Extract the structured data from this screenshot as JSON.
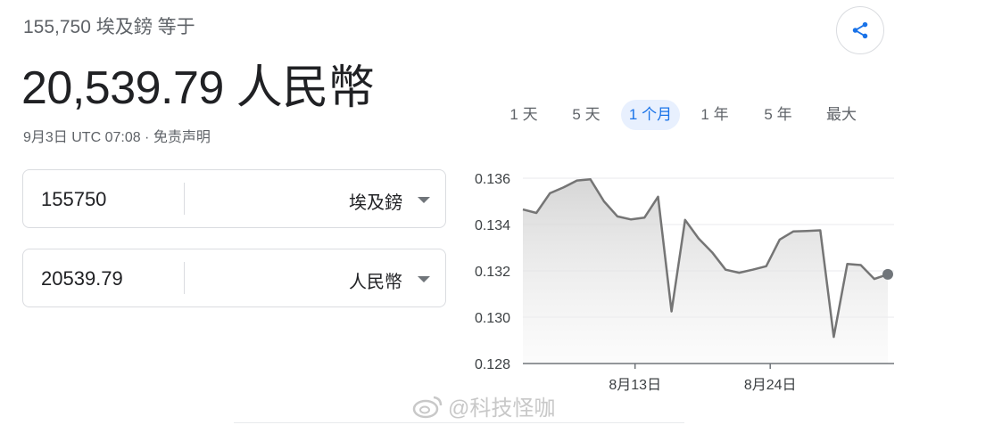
{
  "header": {
    "subtitle": "155,750 埃及鎊 等于",
    "result": "20,539.79 人民幣",
    "meta": "9月3日 UTC 07:08 · 免责声明"
  },
  "converter": {
    "from": {
      "value": "155750",
      "currency": "埃及鎊"
    },
    "to": {
      "value": "20539.79",
      "currency": "人民幣"
    }
  },
  "tabs": [
    {
      "label": "1 天",
      "active": false
    },
    {
      "label": "5 天",
      "active": false
    },
    {
      "label": "1 个月",
      "active": true
    },
    {
      "label": "1 年",
      "active": false
    },
    {
      "label": "5 年",
      "active": false
    },
    {
      "label": "最大",
      "active": false
    }
  ],
  "icons": {
    "share": "share-icon",
    "caret": "chevron-down-icon",
    "watermark": "weibo-icon"
  },
  "colors": {
    "line": "#757575",
    "active_tab": "#1a73e8",
    "active_tab_bg": "#e8f0fe"
  },
  "watermark": "@科技怪咖",
  "chart_data": {
    "type": "line",
    "title": "",
    "xlabel": "",
    "ylabel": "",
    "ylim": [
      0.128,
      0.136
    ],
    "y_ticks": [
      0.136,
      0.134,
      0.132,
      0.13,
      0.128
    ],
    "y_tick_labels": [
      "0.136",
      "0.134",
      "0.132",
      "0.130",
      "0.128"
    ],
    "x_tick_labels": [
      "8月13日",
      "8月24日"
    ],
    "x_tick_positions": [
      8.3,
      18.3
    ],
    "grid": true,
    "series": [
      {
        "values": [
          0.13465,
          0.1345,
          0.13535,
          0.1356,
          0.1359,
          0.13595,
          0.135,
          0.13435,
          0.13422,
          0.1343,
          0.1352,
          0.13025,
          0.1342,
          0.1334,
          0.1328,
          0.13205,
          0.13192,
          0.13205,
          0.1322,
          0.13335,
          0.1337,
          0.13372,
          0.13375,
          0.12915,
          0.1323,
          0.13225,
          0.13165,
          0.13185
        ]
      }
    ]
  }
}
